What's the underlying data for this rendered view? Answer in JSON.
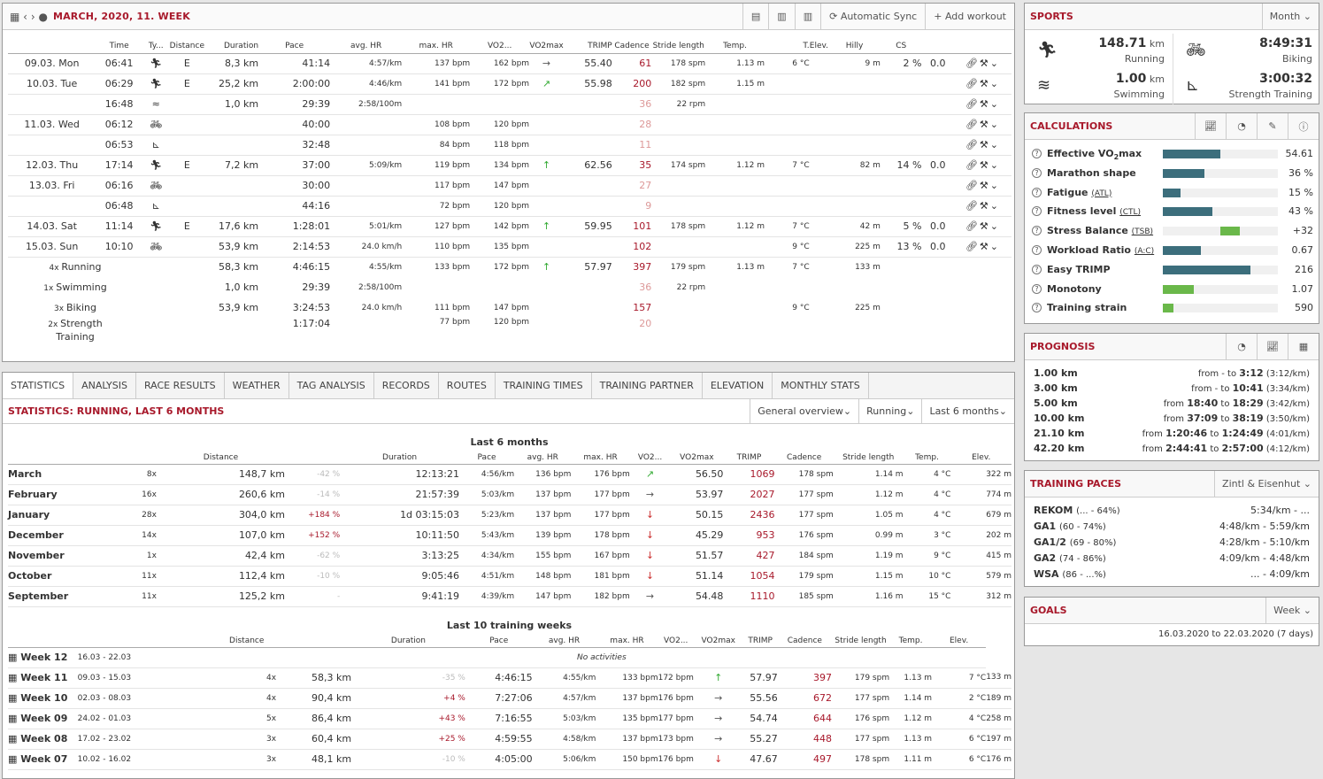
{
  "calendar": {
    "title": "MARCH, 2020, 11. WEEK",
    "sync_label": "Automatic Sync",
    "add_label": "Add workout",
    "columns": [
      "Time",
      "Ty...",
      "Distance",
      "Duration",
      "Pace",
      "avg. HR",
      "max. HR",
      "VO2...",
      "VO2max",
      "TRIMP",
      "Cadence",
      "Stride length",
      "Temp.",
      "T.",
      "Elev.",
      "Hilly",
      "CS"
    ],
    "rows": [
      {
        "date": "09.03. Mon",
        "time": "06:41",
        "sport": "run",
        "type": "E",
        "dist": "8,3 km",
        "dur": "41:14",
        "pace": "4:57/km",
        "avghr": "137 bpm",
        "maxhr": "162 bpm",
        "trend": "→",
        "vo2": "55.40",
        "trimp": "61",
        "cad": "178 spm",
        "stride": "1.13 m",
        "temp": "6 °C",
        "elev": "9 m",
        "hilly": "2 %",
        "cs": "0.0"
      },
      {
        "date": "10.03. Tue",
        "time": "06:29",
        "sport": "run",
        "type": "E",
        "dist": "25,2 km",
        "dur": "2:00:00",
        "pace": "4:46/km",
        "avghr": "141 bpm",
        "maxhr": "172 bpm",
        "trend": "↗",
        "vo2": "55.98",
        "trimp": "200",
        "cad": "182 spm",
        "stride": "1.15 m",
        "temp": "",
        "elev": "",
        "hilly": "",
        "cs": ""
      },
      {
        "date": "",
        "time": "16:48",
        "sport": "swim",
        "type": "",
        "dist": "1,0 km",
        "dur": "29:39",
        "pace": "2:58/100m",
        "avghr": "",
        "maxhr": "",
        "trend": "",
        "vo2": "",
        "trimp": "36",
        "cad": "22 rpm",
        "stride": "",
        "temp": "",
        "elev": "",
        "hilly": "",
        "cs": ""
      },
      {
        "date": "11.03. Wed",
        "time": "06:12",
        "sport": "bike",
        "type": "",
        "dist": "",
        "dur": "40:00",
        "pace": "",
        "avghr": "108 bpm",
        "maxhr": "120 bpm",
        "trend": "",
        "vo2": "",
        "trimp": "28",
        "cad": "",
        "stride": "",
        "temp": "",
        "elev": "",
        "hilly": "",
        "cs": ""
      },
      {
        "date": "",
        "time": "06:53",
        "sport": "strength",
        "type": "",
        "dist": "",
        "dur": "32:48",
        "pace": "",
        "avghr": "84 bpm",
        "maxhr": "118 bpm",
        "trend": "",
        "vo2": "",
        "trimp": "11",
        "cad": "",
        "stride": "",
        "temp": "",
        "elev": "",
        "hilly": "",
        "cs": ""
      },
      {
        "date": "12.03. Thu",
        "time": "17:14",
        "sport": "run",
        "type": "E",
        "dist": "7,2 km",
        "dur": "37:00",
        "pace": "5:09/km",
        "avghr": "119 bpm",
        "maxhr": "134 bpm",
        "trend": "↑",
        "vo2": "62.56",
        "trimp": "35",
        "cad": "174 spm",
        "stride": "1.12 m",
        "temp": "7 °C",
        "elev": "82 m",
        "hilly": "14 %",
        "cs": "0.0"
      },
      {
        "date": "13.03. Fri",
        "time": "06:16",
        "sport": "bike",
        "type": "",
        "dist": "",
        "dur": "30:00",
        "pace": "",
        "avghr": "117 bpm",
        "maxhr": "147 bpm",
        "trend": "",
        "vo2": "",
        "trimp": "27",
        "cad": "",
        "stride": "",
        "temp": "",
        "elev": "",
        "hilly": "",
        "cs": ""
      },
      {
        "date": "",
        "time": "06:48",
        "sport": "strength",
        "type": "",
        "dist": "",
        "dur": "44:16",
        "pace": "",
        "avghr": "72 bpm",
        "maxhr": "120 bpm",
        "trend": "",
        "vo2": "",
        "trimp": "9",
        "cad": "",
        "stride": "",
        "temp": "",
        "elev": "",
        "hilly": "",
        "cs": ""
      },
      {
        "date": "14.03. Sat",
        "time": "11:14",
        "sport": "run",
        "type": "E",
        "dist": "17,6 km",
        "dur": "1:28:01",
        "pace": "5:01/km",
        "avghr": "127 bpm",
        "maxhr": "142 bpm",
        "trend": "↑",
        "vo2": "59.95",
        "trimp": "101",
        "cad": "178 spm",
        "stride": "1.12 m",
        "temp": "7 °C",
        "elev": "42 m",
        "hilly": "5 %",
        "cs": "0.0"
      },
      {
        "date": "15.03. Sun",
        "time": "10:10",
        "sport": "bike",
        "type": "",
        "dist": "53,9 km",
        "dur": "2:14:53",
        "pace": "24.0 km/h",
        "avghr": "110 bpm",
        "maxhr": "135 bpm",
        "trend": "",
        "vo2": "",
        "trimp": "102",
        "cad": "",
        "stride": "",
        "temp": "9 °C",
        "elev": "225 m",
        "hilly": "13 %",
        "cs": "0.0"
      }
    ],
    "summary": [
      {
        "count": "4x",
        "label": "Running",
        "dist": "58,3 km",
        "dur": "4:46:15",
        "pace": "4:55/km",
        "avghr": "133 bpm",
        "maxhr": "172 bpm",
        "trend": "↑",
        "vo2": "57.97",
        "trimp": "397",
        "cad": "179 spm",
        "stride": "1.13 m",
        "temp": "7 °C",
        "elev": "133 m"
      },
      {
        "count": "1x",
        "label": "Swimming",
        "dist": "1,0 km",
        "dur": "29:39",
        "pace": "2:58/100m",
        "avghr": "",
        "maxhr": "",
        "trend": "",
        "vo2": "",
        "trimp": "36",
        "cad": "22 rpm",
        "stride": "",
        "temp": "",
        "elev": ""
      },
      {
        "count": "3x",
        "label": "Biking",
        "dist": "53,9 km",
        "dur": "3:24:53",
        "pace": "24.0 km/h",
        "avghr": "111 bpm",
        "maxhr": "147 bpm",
        "trend": "",
        "vo2": "",
        "trimp": "157",
        "cad": "",
        "stride": "",
        "temp": "9 °C",
        "elev": "225 m"
      },
      {
        "count": "2x",
        "label": "Strength",
        "label2": "Training",
        "dist": "",
        "dur": "1:17:04",
        "pace": "",
        "avghr": "77 bpm",
        "maxhr": "120 bpm",
        "trend": "",
        "vo2": "",
        "trimp": "20",
        "cad": "",
        "stride": "",
        "temp": "",
        "elev": ""
      }
    ]
  },
  "tabs": [
    "STATISTICS",
    "ANALYSIS",
    "RACE RESULTS",
    "WEATHER",
    "TAG ANALYSIS",
    "RECORDS",
    "ROUTES",
    "TRAINING TIMES",
    "TRAINING PARTNER",
    "ELEVATION",
    "MONTHLY STATS"
  ],
  "stats": {
    "title": "STATISTICS: RUNNING, LAST 6 MONTHS",
    "dropdowns": [
      "General overview",
      "Running",
      "Last 6 months"
    ],
    "months_title": "Last 6 months",
    "month_cols": [
      "Distance",
      "Duration",
      "Pace",
      "avg. HR",
      "max. HR",
      "VO2...",
      "VO2max",
      "TRIMP",
      "Cadence",
      "Stride length",
      "Temp.",
      "Elev."
    ],
    "months": [
      {
        "name": "March",
        "count": "8x",
        "dist": "148,7 km",
        "chg": "-42 %",
        "dur": "12:13:21",
        "pace": "4:56/km",
        "avghr": "136 bpm",
        "maxhr": "176 bpm",
        "trend": "↗",
        "vo2": "56.50",
        "trimp": "1069",
        "cad": "178 spm",
        "stride": "1.14 m",
        "temp": "4 °C",
        "elev": "322 m"
      },
      {
        "name": "February",
        "count": "16x",
        "dist": "260,6 km",
        "chg": "-14 %",
        "dur": "21:57:39",
        "pace": "5:03/km",
        "avghr": "137 bpm",
        "maxhr": "177 bpm",
        "trend": "→",
        "vo2": "53.97",
        "trimp": "2027",
        "cad": "177 spm",
        "stride": "1.12 m",
        "temp": "4 °C",
        "elev": "774 m"
      },
      {
        "name": "January",
        "count": "28x",
        "dist": "304,0 km",
        "chg": "+184 %",
        "dur": "1d 03:15:03",
        "pace": "5:23/km",
        "avghr": "137 bpm",
        "maxhr": "177 bpm",
        "trend": "↓",
        "vo2": "50.15",
        "trimp": "2436",
        "cad": "177 spm",
        "stride": "1.05 m",
        "temp": "4 °C",
        "elev": "679 m"
      },
      {
        "name": "December",
        "count": "14x",
        "dist": "107,0 km",
        "chg": "+152 %",
        "dur": "10:11:50",
        "pace": "5:43/km",
        "avghr": "139 bpm",
        "maxhr": "178 bpm",
        "trend": "↓",
        "vo2": "45.29",
        "trimp": "953",
        "cad": "176 spm",
        "stride": "0.99 m",
        "temp": "3 °C",
        "elev": "202 m"
      },
      {
        "name": "November",
        "count": "1x",
        "dist": "42,4 km",
        "chg": "-62 %",
        "dur": "3:13:25",
        "pace": "4:34/km",
        "avghr": "155 bpm",
        "maxhr": "167 bpm",
        "trend": "↓",
        "vo2": "51.57",
        "trimp": "427",
        "cad": "184 spm",
        "stride": "1.19 m",
        "temp": "9 °C",
        "elev": "415 m"
      },
      {
        "name": "October",
        "count": "11x",
        "dist": "112,4 km",
        "chg": "-10 %",
        "dur": "9:05:46",
        "pace": "4:51/km",
        "avghr": "148 bpm",
        "maxhr": "181 bpm",
        "trend": "↓",
        "vo2": "51.14",
        "trimp": "1054",
        "cad": "179 spm",
        "stride": "1.15 m",
        "temp": "10 °C",
        "elev": "579 m"
      },
      {
        "name": "September",
        "count": "11x",
        "dist": "125,2 km",
        "chg": "-",
        "dur": "9:41:19",
        "pace": "4:39/km",
        "avghr": "147 bpm",
        "maxhr": "182 bpm",
        "trend": "→",
        "vo2": "54.48",
        "trimp": "1110",
        "cad": "185 spm",
        "stride": "1.16 m",
        "temp": "15 °C",
        "elev": "312 m"
      }
    ],
    "weeks_title": "Last 10 training weeks",
    "weeks": [
      {
        "name": "Week 12",
        "range": "16.03 - 22.03",
        "note": "No activities"
      },
      {
        "name": "Week 11",
        "range": "09.03 - 15.03",
        "count": "4x",
        "dist": "58,3 km",
        "chg": "-35 %",
        "dur": "4:46:15",
        "pace": "4:55/km",
        "avghr": "133 bpm",
        "maxhr": "172 bpm",
        "trend": "↑",
        "vo2": "57.97",
        "trimp": "397",
        "cad": "179 spm",
        "stride": "1.13 m",
        "temp": "7 °C",
        "elev": "133 m"
      },
      {
        "name": "Week 10",
        "range": "02.03 - 08.03",
        "count": "4x",
        "dist": "90,4 km",
        "chg": "+4 %",
        "dur": "7:27:06",
        "pace": "4:57/km",
        "avghr": "137 bpm",
        "maxhr": "176 bpm",
        "trend": "→",
        "vo2": "55.56",
        "trimp": "672",
        "cad": "177 spm",
        "stride": "1.14 m",
        "temp": "2 °C",
        "elev": "189 m"
      },
      {
        "name": "Week 09",
        "range": "24.02 - 01.03",
        "count": "5x",
        "dist": "86,4 km",
        "chg": "+43 %",
        "dur": "7:16:55",
        "pace": "5:03/km",
        "avghr": "135 bpm",
        "maxhr": "177 bpm",
        "trend": "→",
        "vo2": "54.74",
        "trimp": "644",
        "cad": "176 spm",
        "stride": "1.12 m",
        "temp": "4 °C",
        "elev": "258 m"
      },
      {
        "name": "Week 08",
        "range": "17.02 - 23.02",
        "count": "3x",
        "dist": "60,4 km",
        "chg": "+25 %",
        "dur": "4:59:55",
        "pace": "4:58/km",
        "avghr": "137 bpm",
        "maxhr": "173 bpm",
        "trend": "→",
        "vo2": "55.27",
        "trimp": "448",
        "cad": "177 spm",
        "stride": "1.13 m",
        "temp": "6 °C",
        "elev": "197 m"
      },
      {
        "name": "Week 07",
        "range": "10.02 - 16.02",
        "count": "3x",
        "dist": "48,1 km",
        "chg": "-10 %",
        "dur": "4:05:00",
        "pace": "5:06/km",
        "avghr": "150 bpm",
        "maxhr": "176 bpm",
        "trend": "↓",
        "vo2": "47.67",
        "trimp": "497",
        "cad": "178 spm",
        "stride": "1.11 m",
        "temp": "6 °C",
        "elev": "176 m"
      }
    ]
  },
  "sports": {
    "title": "SPORTS",
    "period": "Month",
    "items": [
      {
        "value": "148.71",
        "unit": "km",
        "label": "Running",
        "icon": "runner-icon"
      },
      {
        "value": "8:49:31",
        "unit": "",
        "label": "Biking",
        "icon": "bike-icon"
      },
      {
        "value": "1.00",
        "unit": "km",
        "label": "Swimming",
        "icon": "swimmer-icon"
      },
      {
        "value": "3:00:32",
        "unit": "",
        "label": "Strength Training",
        "icon": "strength-icon"
      }
    ]
  },
  "calculations": {
    "title": "CALCULATIONS",
    "items": [
      {
        "name": "Effective VO",
        "sub": "2",
        "name2": "max",
        "abbr": "",
        "value": "54.61",
        "fill": 0.5,
        "color": "#3c6e7c"
      },
      {
        "name": "Marathon shape",
        "abbr": "",
        "value": "36 %",
        "fill": 0.36,
        "color": "#3c6e7c"
      },
      {
        "name": "Fatigue",
        "abbr": "(ATL)",
        "value": "15 %",
        "fill": 0.15,
        "color": "#3c6e7c"
      },
      {
        "name": "Fitness level",
        "abbr": "(CTL)",
        "value": "43 %",
        "fill": 0.43,
        "color": "#3c6e7c"
      },
      {
        "name": "Stress Balance",
        "abbr": "(TSB)",
        "value": "+32",
        "fill": 0.17,
        "color": "#6ab84a"
      },
      {
        "name": "Workload Ratio",
        "abbr": "(A:C)",
        "value": "0.67",
        "fill": 0.33,
        "color": "#3c6e7c"
      },
      {
        "name": "Easy TRIMP",
        "abbr": "",
        "value": "216",
        "fill": 0.76,
        "color": "#3c6e7c"
      },
      {
        "name": "Monotony",
        "abbr": "",
        "value": "1.07",
        "fill": 0.27,
        "color": "#6ab84a"
      },
      {
        "name": "Training strain",
        "abbr": "",
        "value": "590",
        "fill": 0.09,
        "color": "#6ab84a"
      }
    ]
  },
  "prognosis": {
    "title": "PROGNOSIS",
    "items": [
      {
        "dist": "1.00 km",
        "from": "from",
        "fval": "",
        "to": "to",
        "tval": "3:12",
        "pace": "(3:12/km)"
      },
      {
        "dist": "3.00 km",
        "from": "from",
        "fval": "",
        "to": "to",
        "tval": "10:41",
        "pace": "(3:34/km)"
      },
      {
        "dist": "5.00 km",
        "from": "from",
        "fval": "18:40",
        "to": "to",
        "tval": "18:29",
        "pace": "(3:42/km)"
      },
      {
        "dist": "10.00 km",
        "from": "from",
        "fval": "37:09",
        "to": "to",
        "tval": "38:19",
        "pace": "(3:50/km)"
      },
      {
        "dist": "21.10 km",
        "from": "from",
        "fval": "1:20:46",
        "to": "to",
        "tval": "1:24:49",
        "pace": "(4:01/km)"
      },
      {
        "dist": "42.20 km",
        "from": "from",
        "fval": "2:44:41",
        "to": "to",
        "tval": "2:57:00",
        "pace": "(4:12/km)"
      }
    ]
  },
  "paces": {
    "title": "TRAINING PACES",
    "method": "Zintl & Eisenhut",
    "items": [
      {
        "name": "REKOM",
        "range": "(... - 64%)",
        "value": "5:34/km - ..."
      },
      {
        "name": "GA1",
        "range": "(60 - 74%)",
        "value": "4:48/km - 5:59/km"
      },
      {
        "name": "GA1/2",
        "range": "(69 - 80%)",
        "value": "4:28/km - 5:10/km"
      },
      {
        "name": "GA2",
        "range": "(74 - 86%)",
        "value": "4:09/km - 4:48/km"
      },
      {
        "name": "WSA",
        "range": "(86 - ...%)",
        "value": "... - 4:09/km"
      }
    ]
  },
  "goals": {
    "title": "GOALS",
    "period": "Week",
    "range": "16.03.2020 to 22.03.2020 (7 days)"
  }
}
